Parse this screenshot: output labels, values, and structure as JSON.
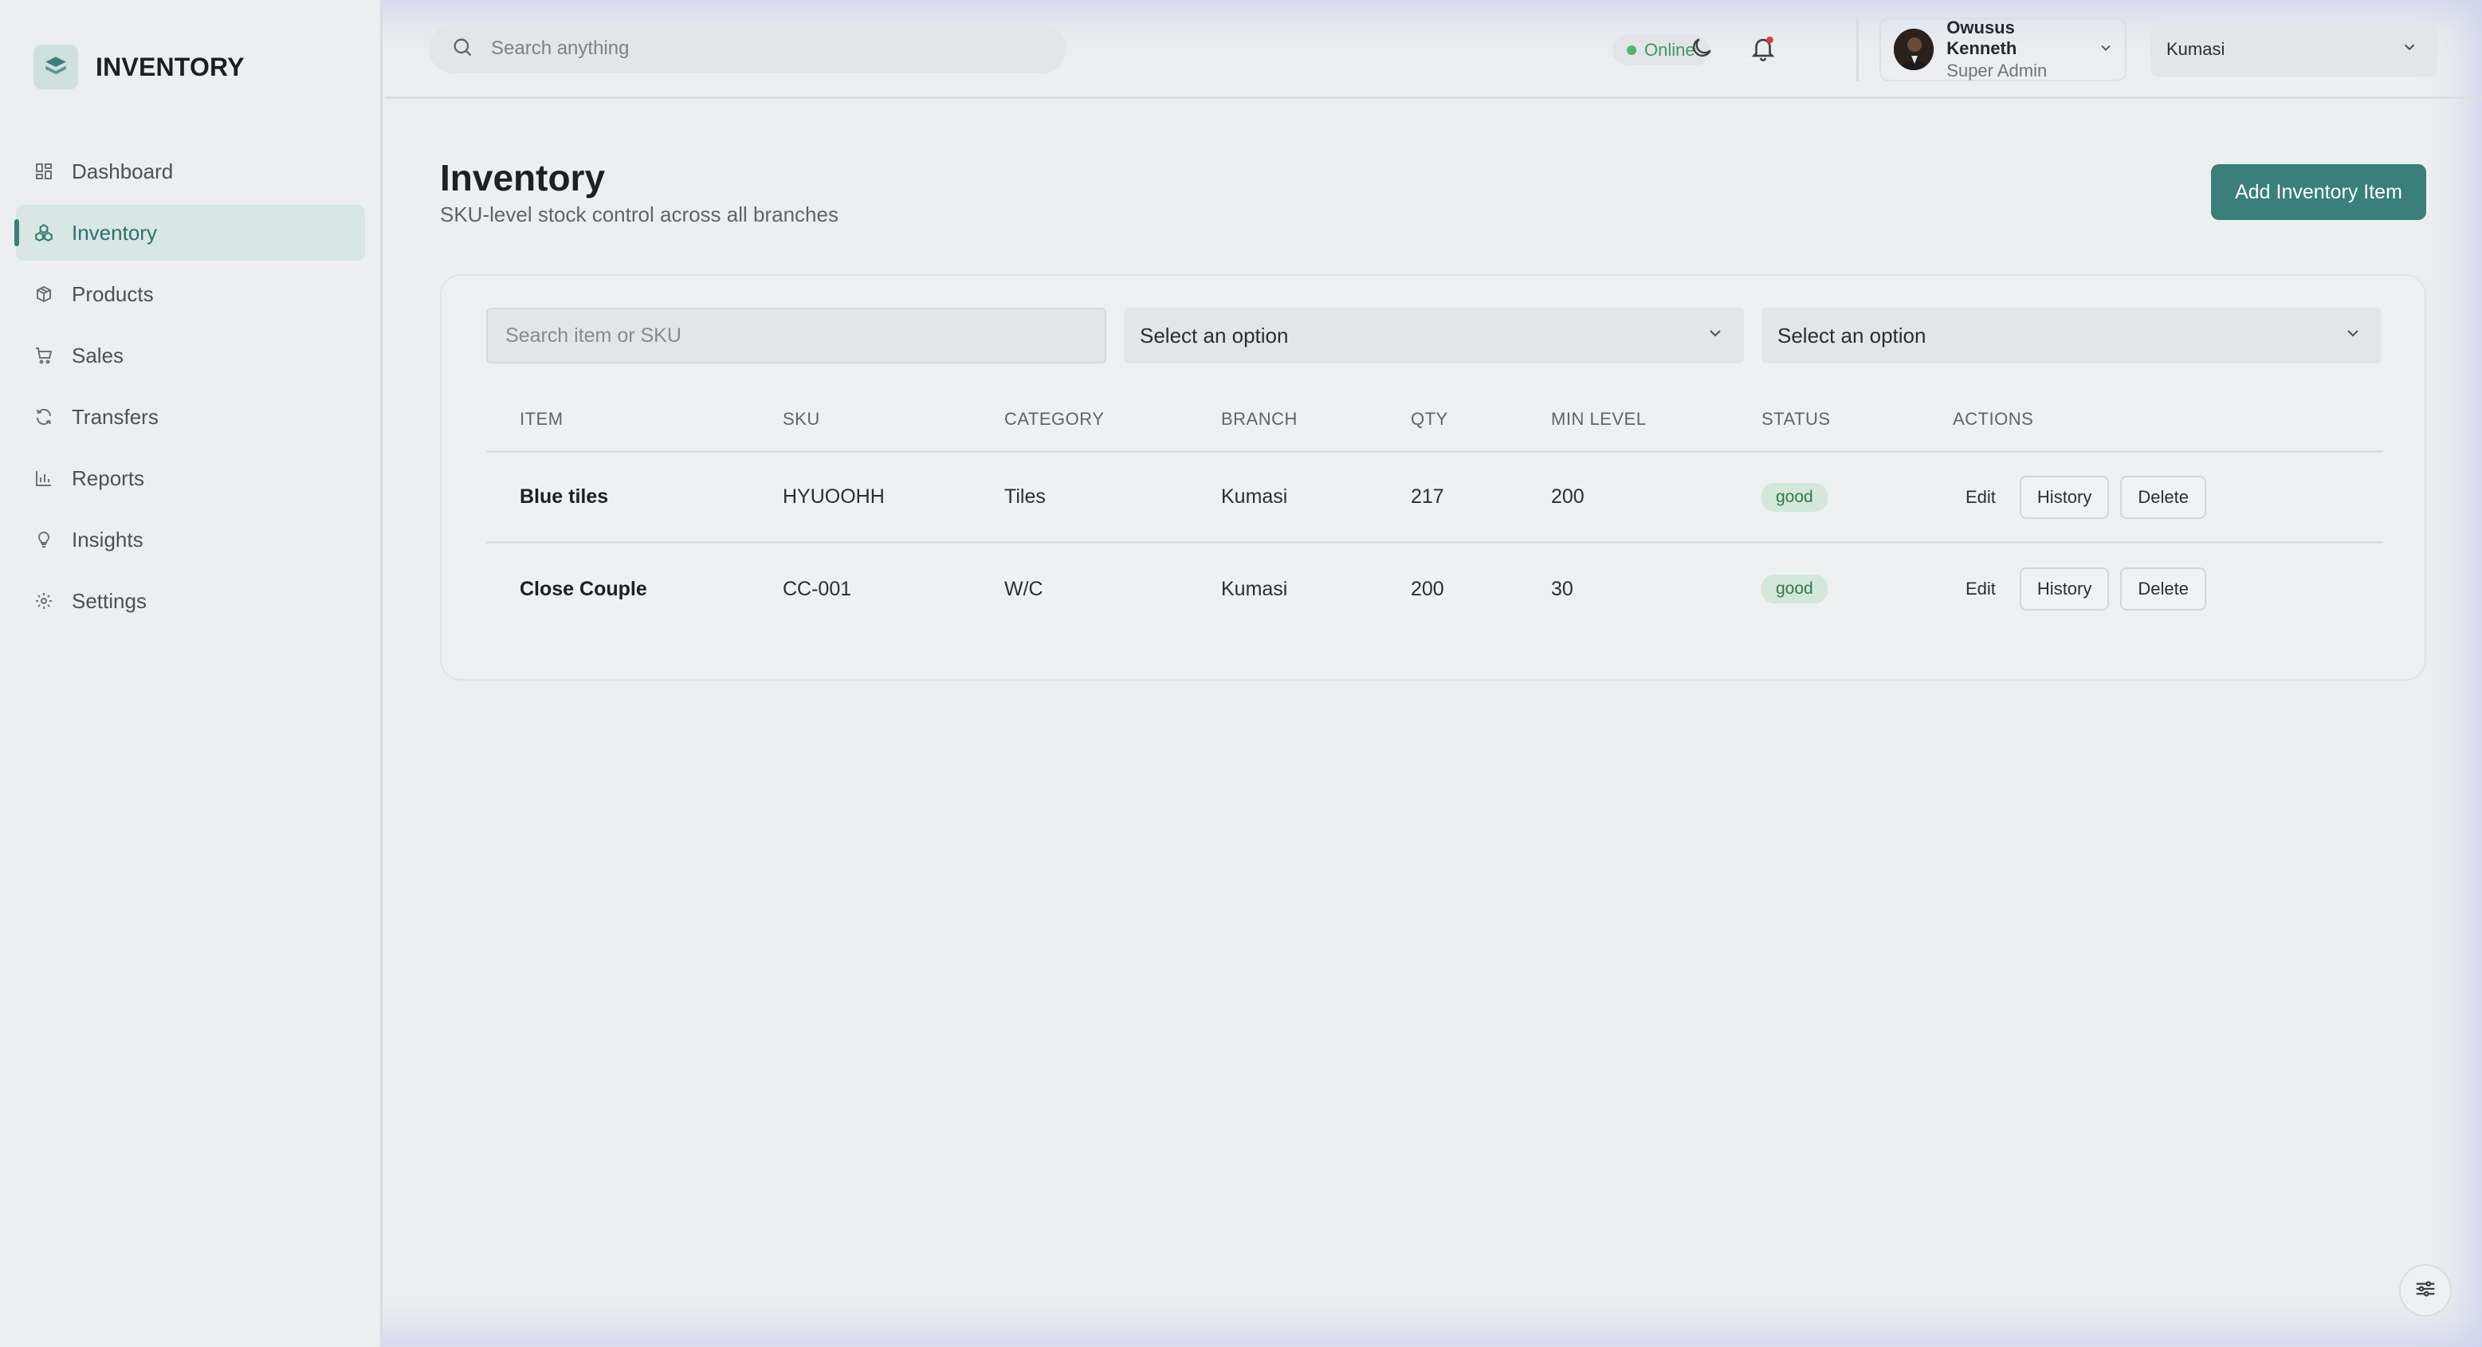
{
  "app": {
    "name": "INVENTORY"
  },
  "sidebar": {
    "items": [
      {
        "label": "Dashboard",
        "icon": "dashboard-icon"
      },
      {
        "label": "Inventory",
        "icon": "inventory-icon",
        "active": true
      },
      {
        "label": "Products",
        "icon": "products-icon"
      },
      {
        "label": "Sales",
        "icon": "cart-icon"
      },
      {
        "label": "Transfers",
        "icon": "transfer-icon"
      },
      {
        "label": "Reports",
        "icon": "chart-icon"
      },
      {
        "label": "Insights",
        "icon": "lightbulb-icon"
      },
      {
        "label": "Settings",
        "icon": "gear-icon"
      }
    ]
  },
  "topbar": {
    "search_placeholder": "Search anything",
    "status": "Online",
    "user": {
      "name": "Owusus Kenneth",
      "role": "Super Admin"
    },
    "branch": "Kumasi"
  },
  "page": {
    "title": "Inventory",
    "subtitle": "SKU-level stock control across all branches",
    "add_button": "Add Inventory Item"
  },
  "filters": {
    "search_placeholder": "Search item or SKU",
    "select1": "Select an option",
    "select2": "Select an option"
  },
  "table": {
    "headers": [
      "ITEM",
      "SKU",
      "CATEGORY",
      "BRANCH",
      "QTY",
      "MIN LEVEL",
      "STATUS",
      "ACTIONS"
    ],
    "rows": [
      {
        "item": "Blue tiles",
        "sku": "HYUOOHH",
        "category": "Tiles",
        "branch": "Kumasi",
        "qty": "217",
        "min_level": "200",
        "status": "good"
      },
      {
        "item": "Close Couple",
        "sku": "CC-001",
        "category": "W/C",
        "branch": "Kumasi",
        "qty": "200",
        "min_level": "30",
        "status": "good"
      }
    ],
    "actions": {
      "edit": "Edit",
      "history": "History",
      "delete": "Delete"
    }
  },
  "colors": {
    "accent": "#3a7f79",
    "good_badge_bg": "#d3e7db",
    "good_badge_text": "#2f7a4c",
    "online": "#4fb46e"
  }
}
